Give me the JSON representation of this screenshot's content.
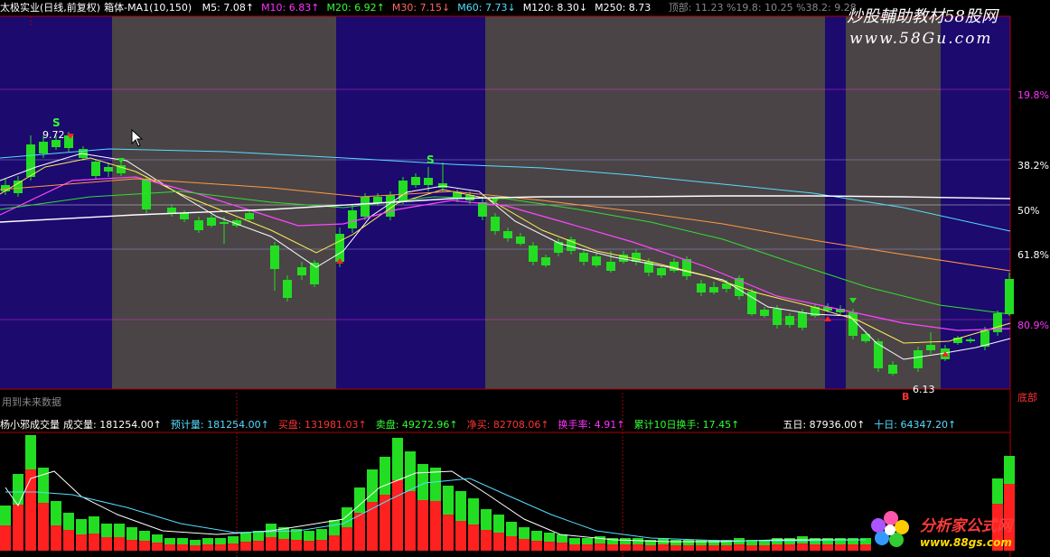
{
  "header": {
    "stock_name": "太极实业(日线,前复权)",
    "indicator": "箱体-MA1(10,150)",
    "ma": [
      {
        "label": "M5: 7.08",
        "arrow": "↑",
        "color": "#ffffff"
      },
      {
        "label": "M10: 6.83",
        "arrow": "↑",
        "color": "#ff33ff"
      },
      {
        "label": "M20: 6.92",
        "arrow": "↑",
        "color": "#33ff33"
      },
      {
        "label": "M30: 7.15",
        "arrow": "↓",
        "color": "#ff6666"
      },
      {
        "label": "M60: 7.73",
        "arrow": "↓",
        "color": "#55ddff"
      },
      {
        "label": "M120: 8.30",
        "arrow": "↓",
        "color": "#ffffff"
      },
      {
        "label": "M250: 8.73",
        "arrow": "",
        "color": "#ffffff"
      }
    ],
    "extra": "顶部: 11.23 %19.8: 10.25 %38.2: 9.28"
  },
  "price_panel": {
    "fib_labels": [
      "19.8%",
      "38.2%",
      "50%",
      "61.8%",
      "80.9%",
      "底部"
    ],
    "high_annotation": "9.72",
    "low_annotation": "6.13",
    "low_marker": "B",
    "s_markers": [
      "S",
      "S"
    ],
    "bottom_note": "用到未来数据"
  },
  "volume_header": {
    "title": "杨小邪成交量",
    "items": [
      {
        "label": "成交量: 181254.00",
        "arrow": "↑",
        "color": "#ffffff"
      },
      {
        "label": "预计量: 181254.00",
        "arrow": "↑",
        "color": "#55ddff"
      },
      {
        "label": "买盘: 131981.03",
        "arrow": "↑",
        "color": "#ff3333"
      },
      {
        "label": "卖盘: 49272.96",
        "arrow": "↑",
        "color": "#33ff33"
      },
      {
        "label": "净买: 82708.06",
        "arrow": "↑",
        "color": "#ff3333"
      },
      {
        "label": "换手率: 4.91",
        "arrow": "↑",
        "color": "#ff33ff"
      },
      {
        "label": "累计10日换手: 17.45",
        "arrow": "↑",
        "color": "#33ff33"
      },
      {
        "label": "五日: 87936.00",
        "arrow": "↑",
        "color": "#ffffff"
      },
      {
        "label": "十日: 64347.20",
        "arrow": "↑",
        "color": "#55ddff"
      }
    ]
  },
  "watermarks": {
    "top_text": "炒股輔助教材58股网",
    "top_url": "www.58Gu.com",
    "bottom_text": "分析家公式网",
    "bottom_url": "www.88gs.com"
  },
  "colors": {
    "up": "#ff2020",
    "down": "#22dd22",
    "box_blue": "#1c0a6e",
    "box_gray": "#4a4446"
  }
}
